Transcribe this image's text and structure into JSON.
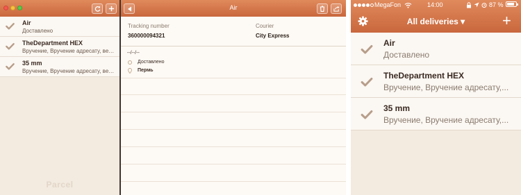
{
  "mac": {
    "deliveries": [
      {
        "title": "Air",
        "status": "Доставлено"
      },
      {
        "title": "TheDepartment HEX",
        "status": "Вручение, Вручение адресату, вес..."
      },
      {
        "title": "35 mm",
        "status": "Вручение, Вручение адресату, вес..."
      }
    ],
    "brand": "Parcel"
  },
  "detail": {
    "title": "Air",
    "tracking_label": "Tracking number",
    "tracking_value": "360000094321",
    "courier_label": "Courier",
    "courier_value": "City Express",
    "history": {
      "date": "--/--/--",
      "status": "Доставлено",
      "location": "Пермь"
    }
  },
  "phone": {
    "carrier": "MegaFon",
    "time": "14:00",
    "battery": "87 %",
    "battery_level": 0.87,
    "nav_title": "All deliveries ▾",
    "add_label": "+",
    "deliveries": [
      {
        "title": "Air",
        "status": "Доставлено"
      },
      {
        "title": "TheDepartment HEX",
        "status": "Вручение, Вручение адресату,..."
      },
      {
        "title": "35 mm",
        "status": "Вручение, Вручение адресату,..."
      }
    ]
  },
  "colors": {
    "accent": "#d2744a",
    "check": "#b79e8a",
    "paper": "#f3ebe0"
  }
}
